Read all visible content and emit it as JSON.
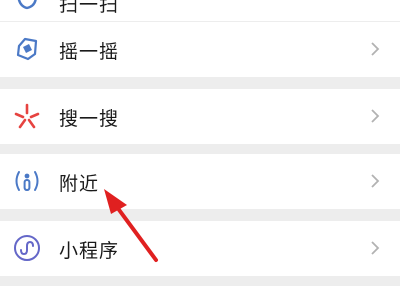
{
  "items": [
    {
      "label": "摇一摇",
      "icon": "shake-icon"
    },
    {
      "label": "搜一搜",
      "icon": "search-burst-icon"
    },
    {
      "label": "附近",
      "icon": "nearby-person-icon"
    },
    {
      "label": "小程序",
      "icon": "mini-program-icon"
    }
  ],
  "top_partial": {
    "label": "扫一扫",
    "icon": "scan-icon"
  },
  "colors": {
    "background": "#ededed",
    "row": "#ffffff",
    "text": "#1a1a1a",
    "chevron": "#b2b2b2",
    "blue_icon": "#4b79c6",
    "search_red": "#e64340",
    "mini_purple": "#6467c8",
    "arrow_red": "#e02020"
  }
}
